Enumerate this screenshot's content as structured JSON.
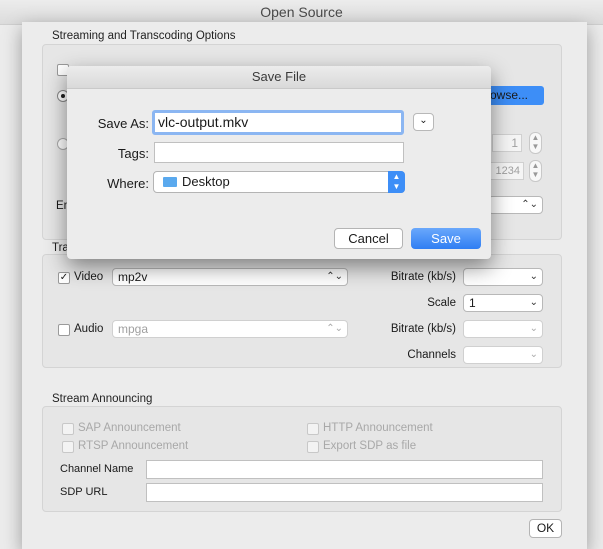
{
  "window": {
    "title": "Open Source"
  },
  "streaming": {
    "group_label": "Streaming and Transcoding Options",
    "browse_label": "rowse...",
    "spin_value": "1",
    "port_value": "1234",
    "encap_prefix": "En",
    "transcode_prefix": "Tra"
  },
  "transcoding": {
    "video_label": "Video",
    "video_checked": "✓",
    "video_codec": "mp2v",
    "video_bitrate_label": "Bitrate (kb/s)",
    "scale_label": "Scale",
    "scale_value": "1",
    "audio_label": "Audio",
    "audio_codec": "mpga",
    "audio_bitrate_label": "Bitrate (kb/s)",
    "channels_label": "Channels"
  },
  "announcing": {
    "group_label": "Stream Announcing",
    "sap_label": "SAP Announcement",
    "rtsp_label": "RTSP Announcement",
    "http_label": "HTTP Announcement",
    "export_sdp_label": "Export SDP as file",
    "channel_name_label": "Channel Name",
    "sdp_url_label": "SDP URL"
  },
  "footer": {
    "ok_label": "OK"
  },
  "save_sheet": {
    "title": "Save File",
    "save_as_label": "Save As:",
    "filename": "vlc-output.mkv",
    "tags_label": "Tags:",
    "where_label": "Where:",
    "where_value": "Desktop",
    "cancel_label": "Cancel",
    "save_label": "Save",
    "colors": {
      "accent": "#3d8ef7",
      "folder": "#5aa9ee"
    }
  }
}
